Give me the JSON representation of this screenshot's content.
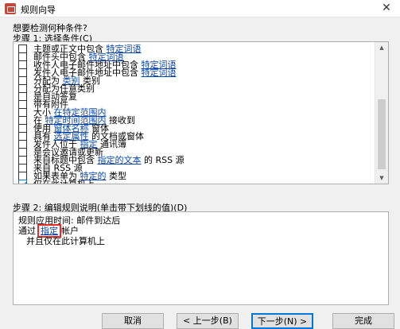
{
  "window": {
    "title": "规则向导",
    "close_glyph": "✕"
  },
  "question": "想要检测何种条件?",
  "step1": {
    "prefix": "步骤 1: 选择条件(",
    "key": "C",
    "suffix": ")"
  },
  "conditions": [
    {
      "checked": false,
      "parts": [
        {
          "t": "主题或正文中包含 "
        },
        {
          "t": "特定词语",
          "link": true
        }
      ]
    },
    {
      "checked": false,
      "parts": [
        {
          "t": "邮件头中包含 "
        },
        {
          "t": "特定词语",
          "link": true
        }
      ]
    },
    {
      "checked": false,
      "parts": [
        {
          "t": "收件人电子邮件地址中包含 "
        },
        {
          "t": "特定词语",
          "link": true
        }
      ]
    },
    {
      "checked": false,
      "parts": [
        {
          "t": "发件人电子邮件地址中包含 "
        },
        {
          "t": "特定词语",
          "link": true
        }
      ]
    },
    {
      "checked": false,
      "parts": [
        {
          "t": "分配为 "
        },
        {
          "t": "类别",
          "link": true
        },
        {
          "t": " 类别"
        }
      ]
    },
    {
      "checked": false,
      "parts": [
        {
          "t": "分配为任意类别"
        }
      ]
    },
    {
      "checked": false,
      "parts": [
        {
          "t": "是自动答复"
        }
      ]
    },
    {
      "checked": false,
      "parts": [
        {
          "t": "带有附件"
        }
      ]
    },
    {
      "checked": false,
      "parts": [
        {
          "t": "大小 "
        },
        {
          "t": "在特定范围内",
          "link": true
        }
      ]
    },
    {
      "checked": false,
      "parts": [
        {
          "t": "在 "
        },
        {
          "t": "特定时间范围内",
          "link": true
        },
        {
          "t": " 接收到"
        }
      ]
    },
    {
      "checked": false,
      "parts": [
        {
          "t": "使用 "
        },
        {
          "t": "窗体名称",
          "link": true
        },
        {
          "t": " 窗体"
        }
      ]
    },
    {
      "checked": false,
      "parts": [
        {
          "t": "具有 "
        },
        {
          "t": "选定属性",
          "link": true
        },
        {
          "t": " 的文档或窗体"
        }
      ]
    },
    {
      "checked": false,
      "parts": [
        {
          "t": "发件人位于 "
        },
        {
          "t": "指定",
          "link": true
        },
        {
          "t": " 通讯簿"
        }
      ]
    },
    {
      "checked": false,
      "parts": [
        {
          "t": "是会议邀请或更新"
        }
      ]
    },
    {
      "checked": false,
      "parts": [
        {
          "t": "来自标题中包含 "
        },
        {
          "t": "指定的文本",
          "link": true
        },
        {
          "t": " 的 RSS 源"
        }
      ]
    },
    {
      "checked": false,
      "parts": [
        {
          "t": "来自 RSS 源"
        }
      ]
    },
    {
      "checked": false,
      "parts": [
        {
          "t": "如果表单为 "
        },
        {
          "t": "特定的",
          "link": true
        },
        {
          "t": " 类型"
        }
      ]
    },
    {
      "checked": true,
      "parts": [
        {
          "t": "仅在此计算机上"
        }
      ]
    }
  ],
  "step2": {
    "prefix": "步骤 2: 编辑规则说明(单击带下划线的值)(",
    "key": "D",
    "suffix": ")"
  },
  "description": {
    "line1": "规则应用时间: 邮件到达后",
    "line2_prefix": "通过",
    "line2_link": "指定",
    "line2_suffix": "帐户",
    "line3": "并且仅在此计算机上"
  },
  "buttons": {
    "cancel": "取消",
    "back": "< 上一步(B)",
    "next": "下一步(N) >",
    "finish": "完成"
  },
  "colors": {
    "link": "#0645ad",
    "highlight": "#e52b2b",
    "accent": "#0078d7"
  },
  "icons": {
    "title": "outlook-rules-icon",
    "close": "close-icon",
    "scroll_up": "scroll-up-arrow",
    "scroll_down": "scroll-down-arrow"
  }
}
